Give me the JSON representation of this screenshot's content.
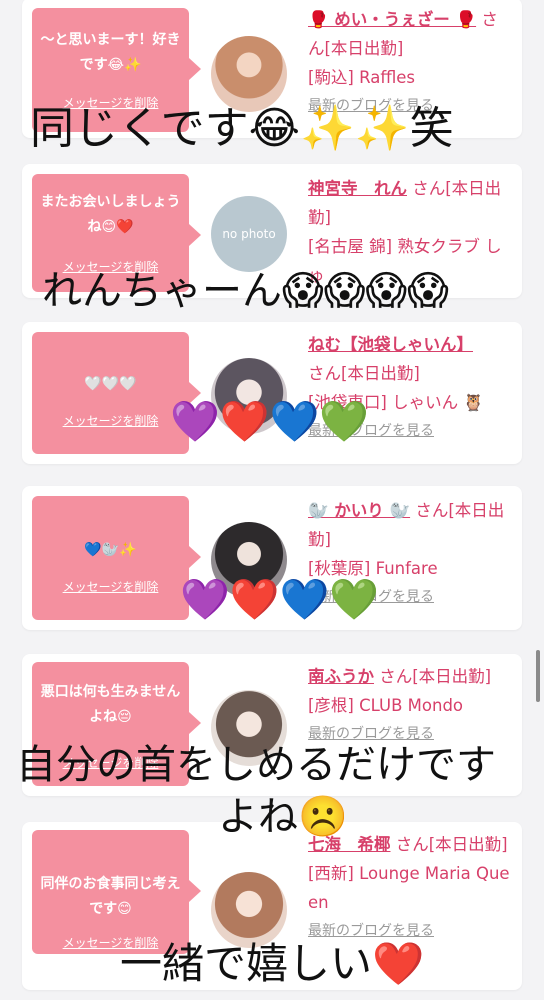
{
  "delete_label": "メッセージを削除",
  "blog_label": "最新のブログを見る",
  "cards": [
    {
      "message": "〜と思いまーす！好きです😂✨",
      "name": "🥊 めい・うぇざー 🥊",
      "status": "さん[本日出勤]",
      "shop": "[駒込] Raffles",
      "avatar_color": "#d9a58f"
    },
    {
      "message": "またお会いしましょうね😊❤️",
      "name": "神宮寺　れん",
      "status": "さん[本日出勤]",
      "shop": "[名古屋 錦] 熟女クラブ しゅ",
      "avatar_text": "no photo",
      "avatar_color": "#b9c8d0"
    },
    {
      "message": "🤍🤍🤍",
      "name": "ねむ【池袋しゃいん】",
      "status": "さん[本日出勤]",
      "shop": "[池袋東口] しゃいん 🦉",
      "avatar_color": "#8c8690"
    },
    {
      "message": "💙🦭✨",
      "name": "🦭 かいり 🦭",
      "status": "さん[本日出勤]",
      "shop": "[秋葉原] Funfare",
      "avatar_color": "#4a4548"
    },
    {
      "message": "悪口は何も生みませんよね😔",
      "name": "南ふうか",
      "status": "さん[本日出勤]",
      "shop": "[彦根] CLUB Mondo",
      "avatar_color": "#c8bcb5"
    },
    {
      "message": "同伴のお食事同じ考えです😊",
      "name": "七海　希椰",
      "status": "さん[本日出勤]",
      "shop": "[西新] Lounge Maria Queen",
      "avatar_color": "#d8b9a8"
    }
  ],
  "overlays": {
    "caption1": "同じくです😂✨✨笑",
    "caption2": "れんちゃーん😱😱😱😱",
    "hearts1": "💜❤️💙💚",
    "hearts2": "💜❤️💙💚",
    "caption3_line1": "自分の首をしめるだけです",
    "caption3_line2": "よね☹️",
    "caption4": "一緒で嬉しい❤️"
  }
}
